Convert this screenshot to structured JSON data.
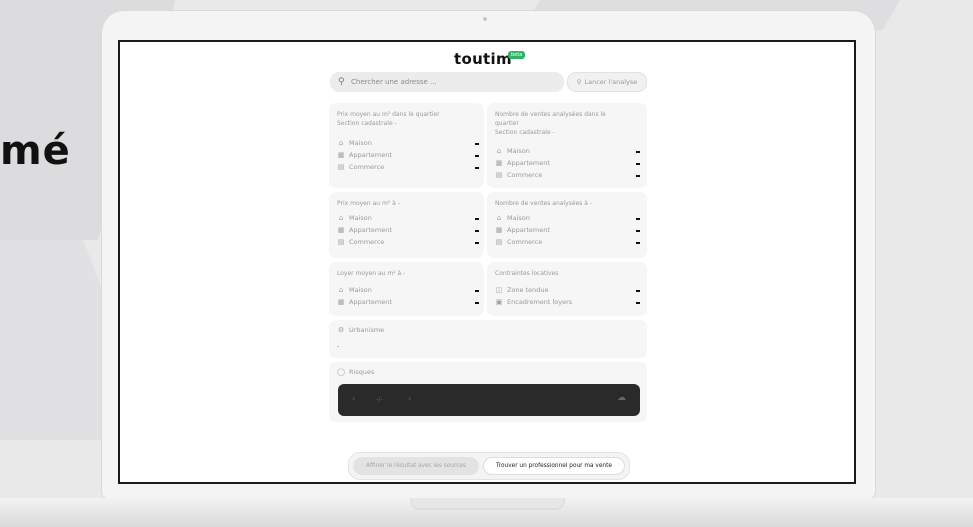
{
  "side_text": "mé",
  "app": {
    "logo": "toutim",
    "badge": "beta",
    "accent_color": "#2fb36a"
  },
  "search": {
    "placeholder": "Chercher une adresse ...",
    "launch_label": "Lancer l'analyse"
  },
  "cards": {
    "price_quarter": {
      "title_line1": "Prix moyen au m² dans le quartier",
      "title_line2": "Section cadastrale -",
      "rows": [
        {
          "icon": "house-icon",
          "label": "Maison",
          "value": "-"
        },
        {
          "icon": "building-icon",
          "label": "Appartement",
          "value": "-"
        },
        {
          "icon": "shop-icon",
          "label": "Commerce",
          "value": "-"
        }
      ]
    },
    "sales_quarter": {
      "title_line1": "Nombre de ventes analysées dans le",
      "title_line2": "quartier",
      "title_line3": "Section cadastrale -",
      "rows": [
        {
          "icon": "house-icon",
          "label": "Maison",
          "value": "-"
        },
        {
          "icon": "building-icon",
          "label": "Appartement",
          "value": "-"
        },
        {
          "icon": "shop-icon",
          "label": "Commerce",
          "value": "-"
        }
      ]
    },
    "price_city": {
      "title": "Prix moyen au m² à -",
      "rows": [
        {
          "icon": "house-icon",
          "label": "Maison",
          "value": "-"
        },
        {
          "icon": "building-icon",
          "label": "Appartement",
          "value": "-"
        },
        {
          "icon": "shop-icon",
          "label": "Commerce",
          "value": "-"
        }
      ]
    },
    "sales_city": {
      "title": "Nombre de ventes analysées à -",
      "rows": [
        {
          "icon": "house-icon",
          "label": "Maison",
          "value": "-"
        },
        {
          "icon": "building-icon",
          "label": "Appartement",
          "value": "-"
        },
        {
          "icon": "shop-icon",
          "label": "Commerce",
          "value": "-"
        }
      ]
    },
    "rent_city": {
      "title": "Loyer moyen au m² à -",
      "rows": [
        {
          "icon": "house-icon",
          "label": "Maison",
          "value": "-"
        },
        {
          "icon": "building-icon",
          "label": "Appartement",
          "value": "-"
        }
      ]
    },
    "rental_constraints": {
      "title": "Contraintes locatives",
      "rows": [
        {
          "icon": "grid-icon",
          "label": "Zone tendue",
          "value": "-"
        },
        {
          "icon": "frame-icon",
          "label": "Encadrement loyers",
          "value": "-"
        }
      ]
    },
    "urbanism": {
      "title": "Urbanisme",
      "value": "-"
    },
    "risks": {
      "title": "Risques",
      "pager": "-/-"
    }
  },
  "bottom": {
    "refine_label": "Affiner le résultat avec les sources",
    "pro_label": "Trouver un professionnel pour ma vente"
  }
}
